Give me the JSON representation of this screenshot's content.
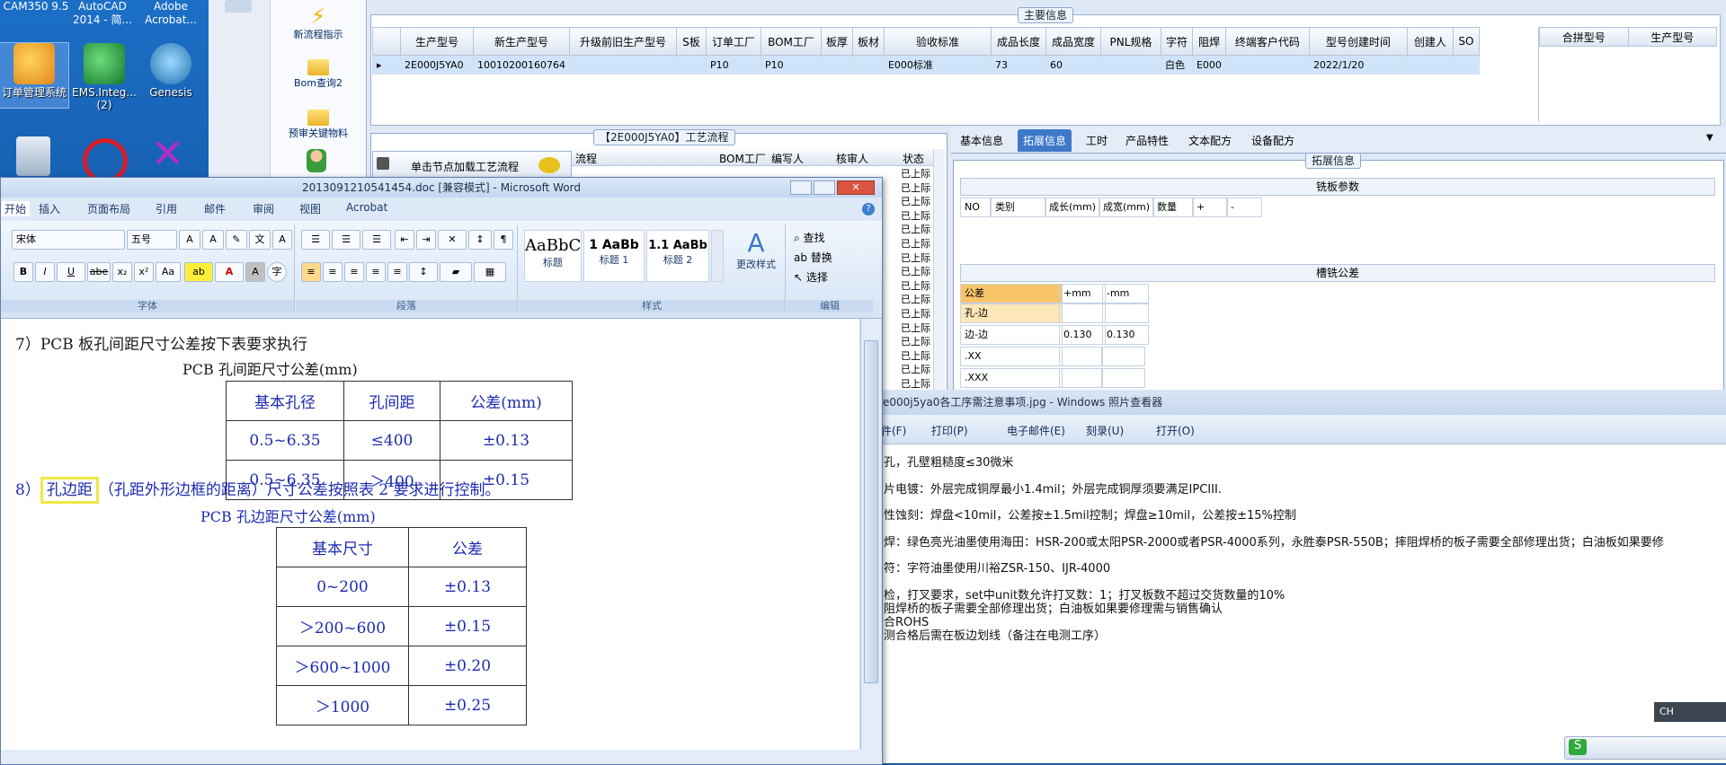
{
  "desktop": {
    "top_labels": [
      "CAM350 9.5",
      "AutoCAD 2014 - 简...",
      "Adobe Acrobat..."
    ],
    "icons": [
      {
        "label": "订单管理系统",
        "color": "#f3a21c"
      },
      {
        "label": "EMS.Integ... (2)",
        "color": "#1e9a3a"
      },
      {
        "label": "Genesis",
        "color": "#2a8fd0"
      }
    ]
  },
  "erp": {
    "tools": [
      {
        "label": "新流程指示",
        "icon": "lightning-icon"
      },
      {
        "label": "Bom查询2",
        "icon": "folder-icon"
      },
      {
        "label": "预审关键物料",
        "icon": "folder-icon"
      }
    ],
    "main_info": {
      "title": "主要信息",
      "columns": [
        "生产型号",
        "新生产型号",
        "升级前旧生产型号",
        "S板",
        "订单工厂",
        "BOM工厂",
        "板厚",
        "板材",
        "验收标准",
        "成品长度",
        "成品宽度",
        "PNL规格",
        "字符",
        "阻焊",
        "终端客户代码",
        "型号创建时间",
        "创建人",
        "SO"
      ],
      "row": [
        "2E000J5YA0",
        "10010200160764",
        "",
        "",
        "P10",
        "P10",
        "",
        "",
        "E000标准",
        "73",
        "60",
        "",
        "白色",
        "E000",
        "",
        "2022/1/20",
        "",
        ""
      ]
    },
    "merge_panel": {
      "columns": [
        "合拼型号",
        "生产型号"
      ]
    },
    "process": {
      "title": "【2E000J5YA0】工艺流程",
      "load_button": "单击节点加载工艺流程",
      "columns": [
        "流程",
        "BOM工厂",
        "编写人",
        "核审人",
        "状态"
      ],
      "status_values": [
        "已上际",
        "已上际",
        "已上际",
        "已上际",
        "已上际",
        "已上际",
        "已上际",
        "已上际",
        "已上际",
        "已上际",
        "已上际",
        "已上际",
        "已上际",
        "已上际",
        "已上际",
        "已上际"
      ]
    },
    "detail_tabs": [
      "基本信息",
      "拓展信息",
      "工时",
      "产品特性",
      "文本配方",
      "设备配方"
    ],
    "ext": {
      "title": "拓展信息",
      "mill_title": "铣板参数",
      "mill_columns": [
        "NO",
        "类别",
        "成长(mm)",
        "成宽(mm)",
        "数量",
        "+",
        "-"
      ],
      "slot_title": "槽铣公差",
      "slot_header": [
        "公差",
        "+mm",
        "-mm"
      ],
      "slot_rows": [
        [
          "孔-边",
          "",
          ""
        ],
        [
          "边-边",
          "0.130",
          "0.130"
        ],
        [
          ".XX",
          "",
          ""
        ],
        [
          ".XXX",
          "",
          ""
        ]
      ]
    }
  },
  "word": {
    "title": "2013091210541454.doc [兼容模式] - Microsoft Word",
    "tabs": [
      "开始",
      "插入",
      "页面布局",
      "引用",
      "邮件",
      "审阅",
      "视图",
      "Acrobat"
    ],
    "font_name": "宋体",
    "font_size": "五号",
    "groups": [
      "字体",
      "段落",
      "样式",
      "编辑"
    ],
    "styles": [
      {
        "preview": "AaBbC",
        "name": "标题"
      },
      {
        "preview": "1 AaBb",
        "name": "标题 1"
      },
      {
        "preview": "1.1 AaBb",
        "name": "标题 2"
      }
    ],
    "change_style": "更改样式",
    "edit": [
      "查找",
      "替换",
      "选择"
    ],
    "doc": {
      "line7": "7）PCB 板孔间距尺寸公差按下表要求执行",
      "table1_title": "PCB 孔间距尺寸公差(mm)",
      "table1": [
        [
          "基本孔径",
          "孔间距",
          "公差(mm)"
        ],
        [
          "0.5~6.35",
          "≤400",
          "±0.13"
        ],
        [
          "0.5~6.35",
          "＞400",
          "±0.15"
        ]
      ],
      "line8_num": "8）",
      "line8_highlight": "孔边距",
      "line8_rest": "（孔距外形边框的距离）尺寸公差按照表 2 要求进行控制。",
      "table2_title": "PCB 孔边距尺寸公差(mm)",
      "table2": [
        [
          "基本尺寸",
          "公差"
        ],
        [
          "0~200",
          "±0.13"
        ],
        [
          "＞200~600",
          "±0.15"
        ],
        [
          "＞600~1000",
          "±0.20"
        ],
        [
          "＞1000",
          "±0.25"
        ]
      ]
    }
  },
  "viewer": {
    "title": "e000j5ya0各工序需注意事项.jpg - Windows 照片查看器",
    "menu": [
      "件(F)",
      "打印(P)",
      "电子邮件(E)",
      "刻录(U)",
      "打开(O)"
    ],
    "lines": [
      "孔，孔壁粗糙度≤30微米",
      "片电镀：外层完成铜厚最小1.4mil；外层完成铜厚须要满足IPCIII.",
      "性蚀刻：焊盘<10mil，公差按±1.5mil控制；焊盘≥10mil，公差按±15%控制",
      "焊：绿色亮光油墨使用海田：HSR-200或太阳PSR-2000或者PSR-4000系列，永胜泰PSR-550B；摔阻焊桥的板子需要全部修理出货；白油板如果要修",
      "符：字符油墨使用川裕ZSR-150、IJR-4000",
      "检，打叉要求，set中unit数允许打叉数：1；打叉板数不超过交货数量的10%",
      "阻焊桥的板子需要全部修理出货；白油板如果要修理需与销售确认",
      "合ROHS",
      "测合格后需在板边划线（备注在电测工序）"
    ]
  },
  "taskbar": {
    "ime": "CH"
  }
}
